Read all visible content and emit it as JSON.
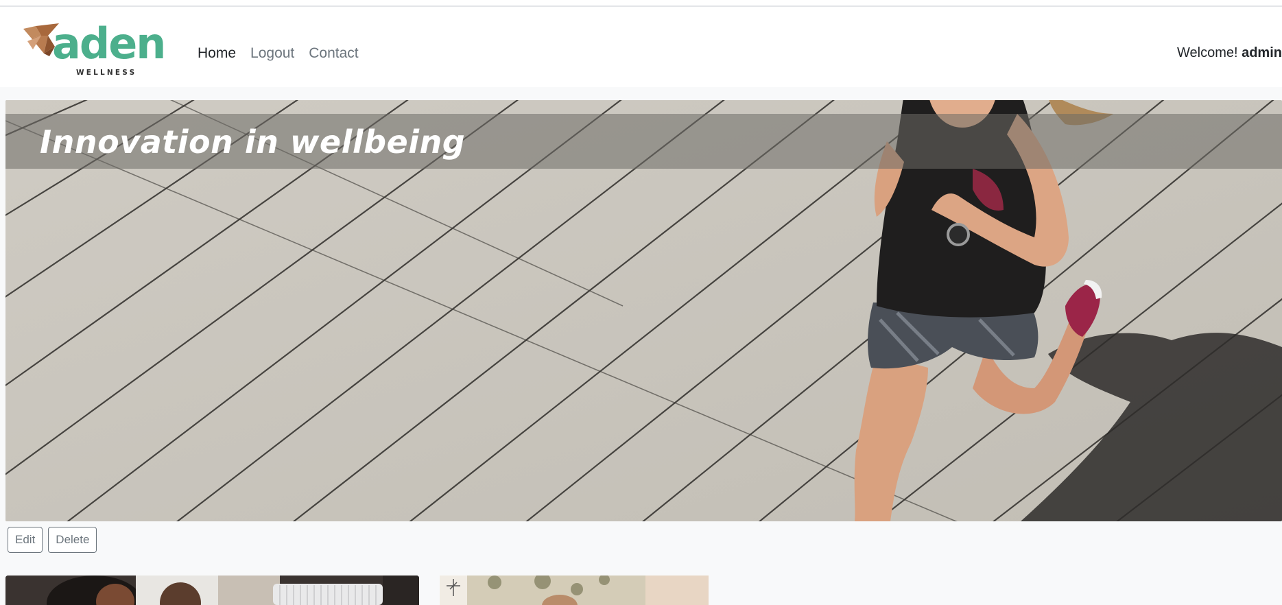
{
  "brand": {
    "name": "aden",
    "tagline": "WELLNESS",
    "mark_color": "#b4794d",
    "text_color": "#4caf8c"
  },
  "nav": {
    "items": [
      {
        "label": "Home",
        "active": true
      },
      {
        "label": "Logout",
        "active": false
      },
      {
        "label": "Contact",
        "active": false
      }
    ]
  },
  "user": {
    "welcome_prefix": "Welcome!",
    "username": "admin"
  },
  "hero": {
    "caption": "Innovation in wellbeing"
  },
  "actions": {
    "edit_label": "Edit",
    "delete_label": "Delete"
  }
}
